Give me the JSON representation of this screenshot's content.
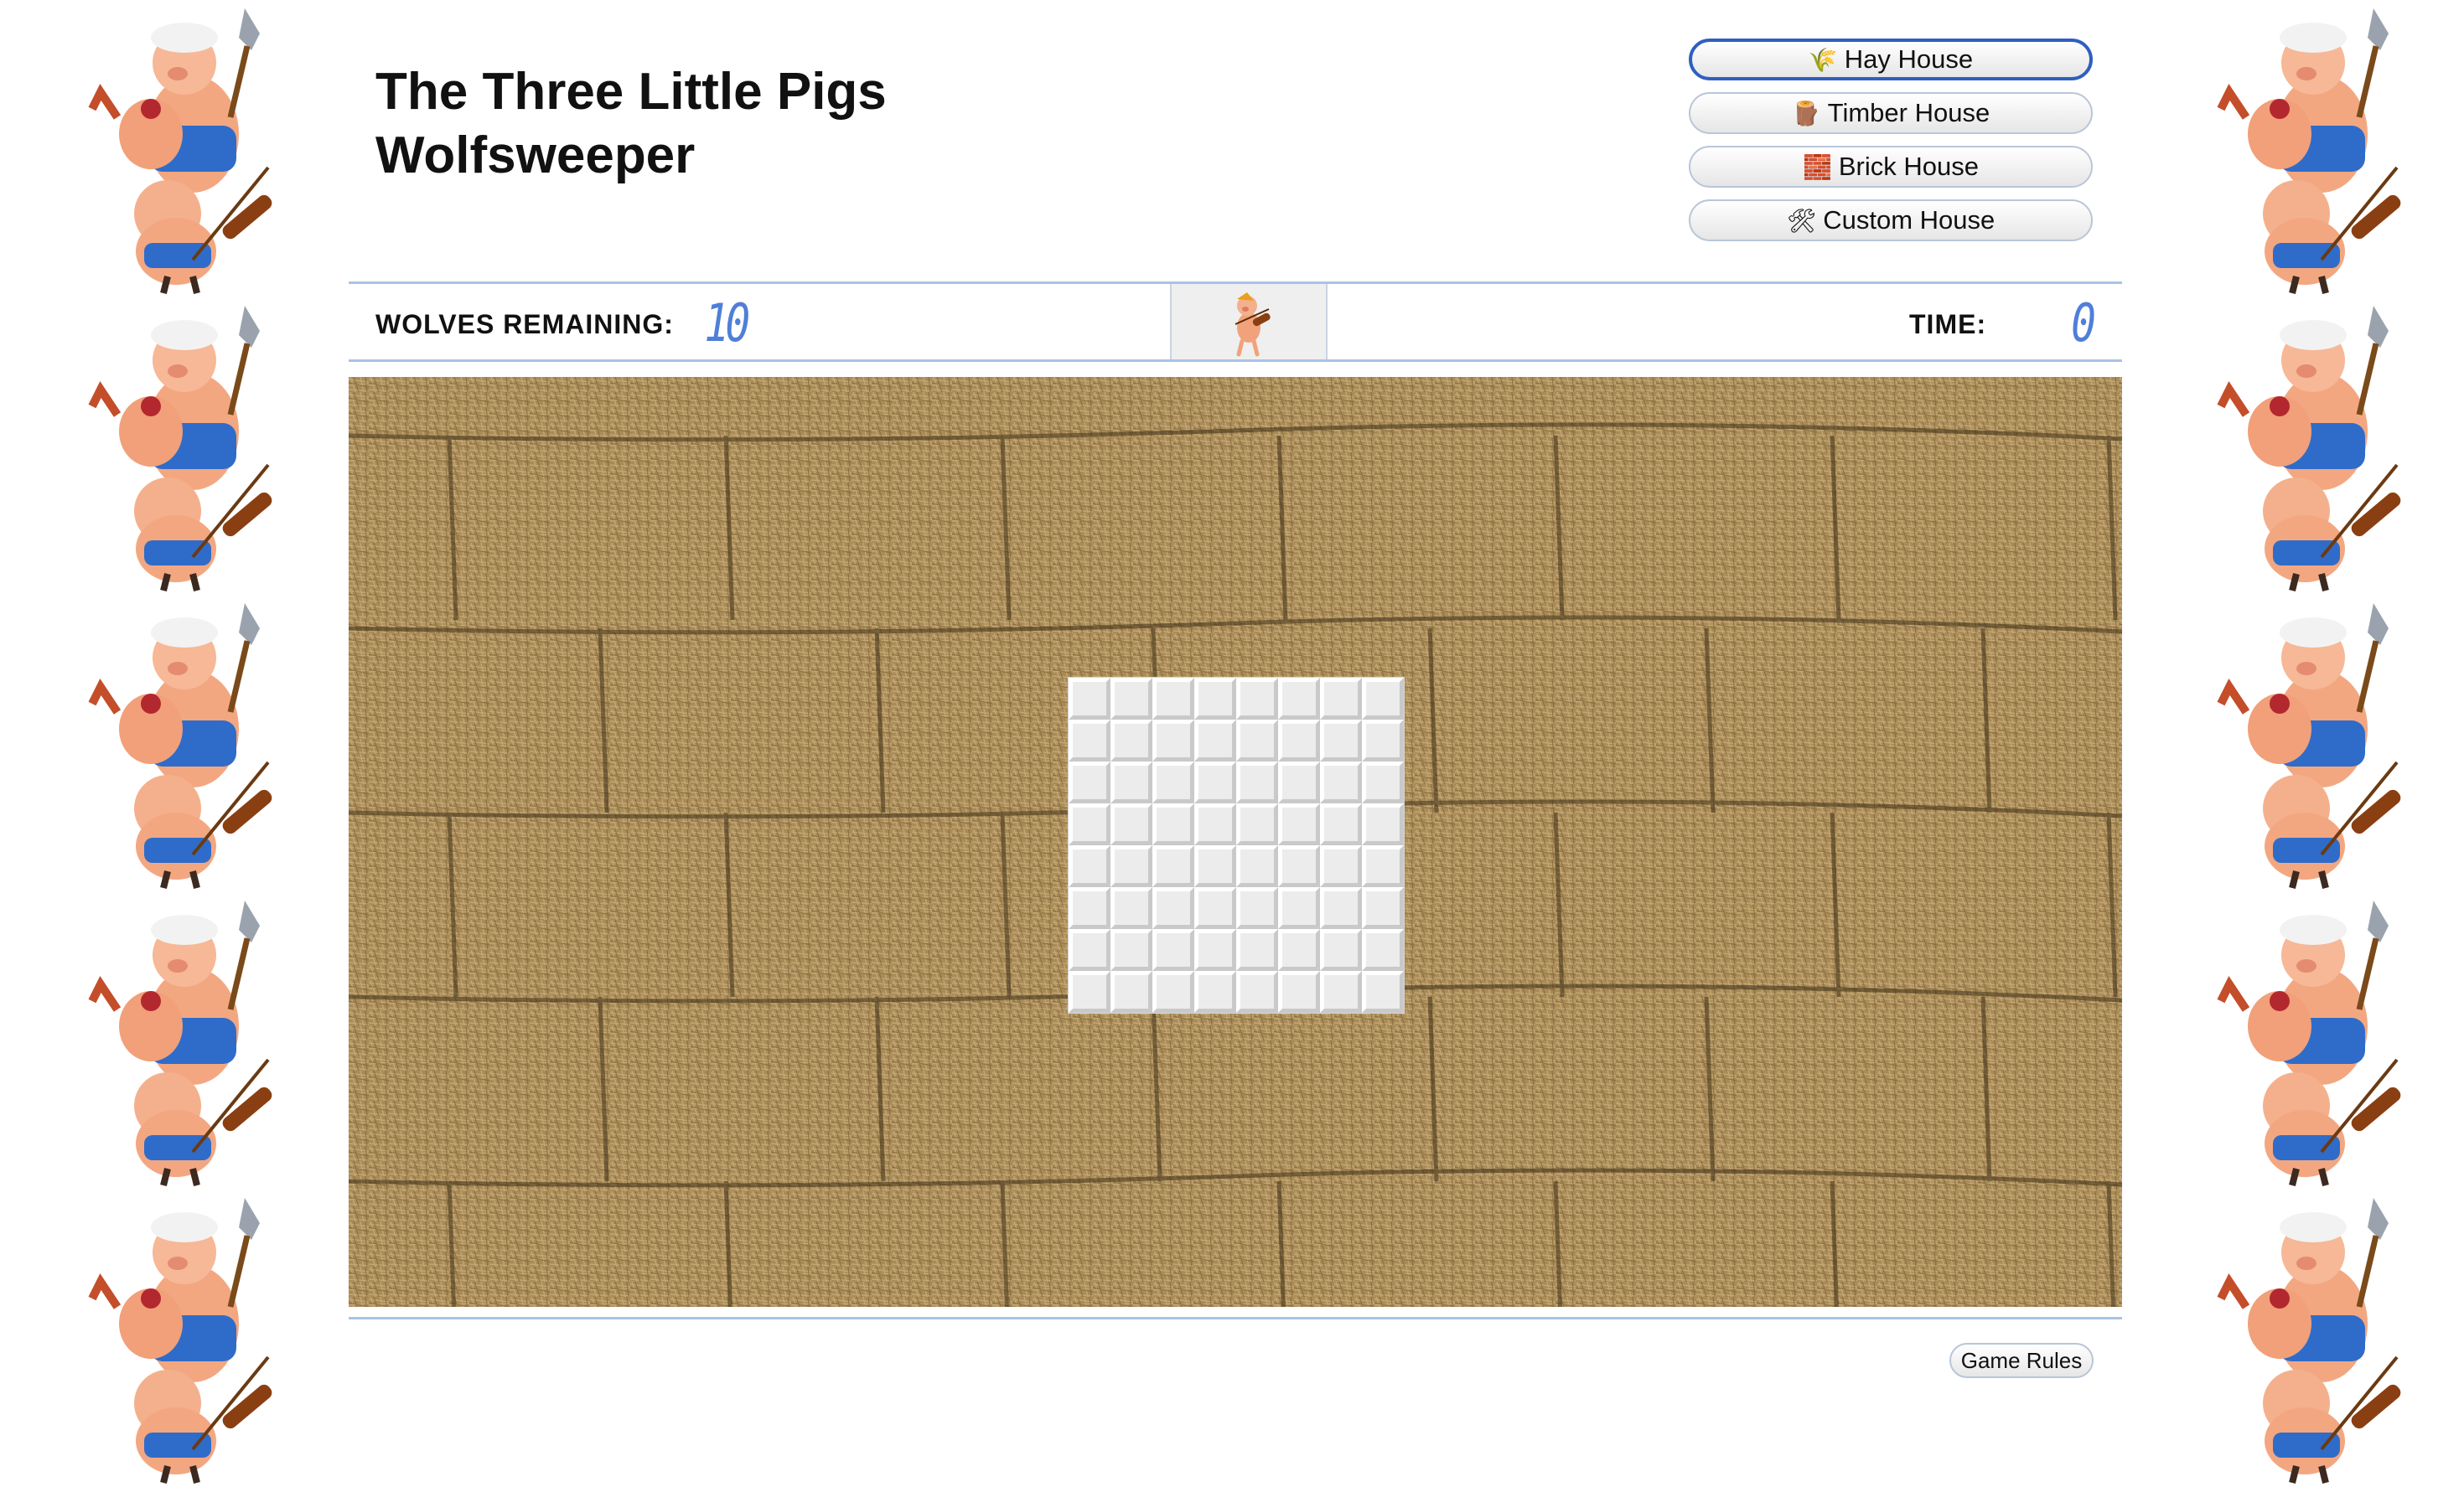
{
  "title": {
    "line1": "The Three Little Pigs",
    "line2": "Wolfsweeper"
  },
  "levels": [
    {
      "label": "Hay House",
      "icon": "hay-icon",
      "glyph": "🌾",
      "active": true
    },
    {
      "label": "Timber House",
      "icon": "timber-icon",
      "glyph": "🪵",
      "active": false
    },
    {
      "label": "Brick House",
      "icon": "brick-icon",
      "glyph": "🧱",
      "active": false
    },
    {
      "label": "Custom House",
      "icon": "tools-icon",
      "glyph": "🛠",
      "active": false
    }
  ],
  "hud": {
    "wolves_label": "WOLVES REMAINING:",
    "wolves_count": "10",
    "time_label": "TIME:",
    "time_value": "0"
  },
  "board": {
    "rows": 8,
    "cols": 8,
    "background": "hay-bales"
  },
  "footer": {
    "rules_label": "Game Rules"
  },
  "colors": {
    "accent": "#4f7fd8",
    "divider": "#a9c3e6",
    "active_border": "#2f5fc0"
  }
}
